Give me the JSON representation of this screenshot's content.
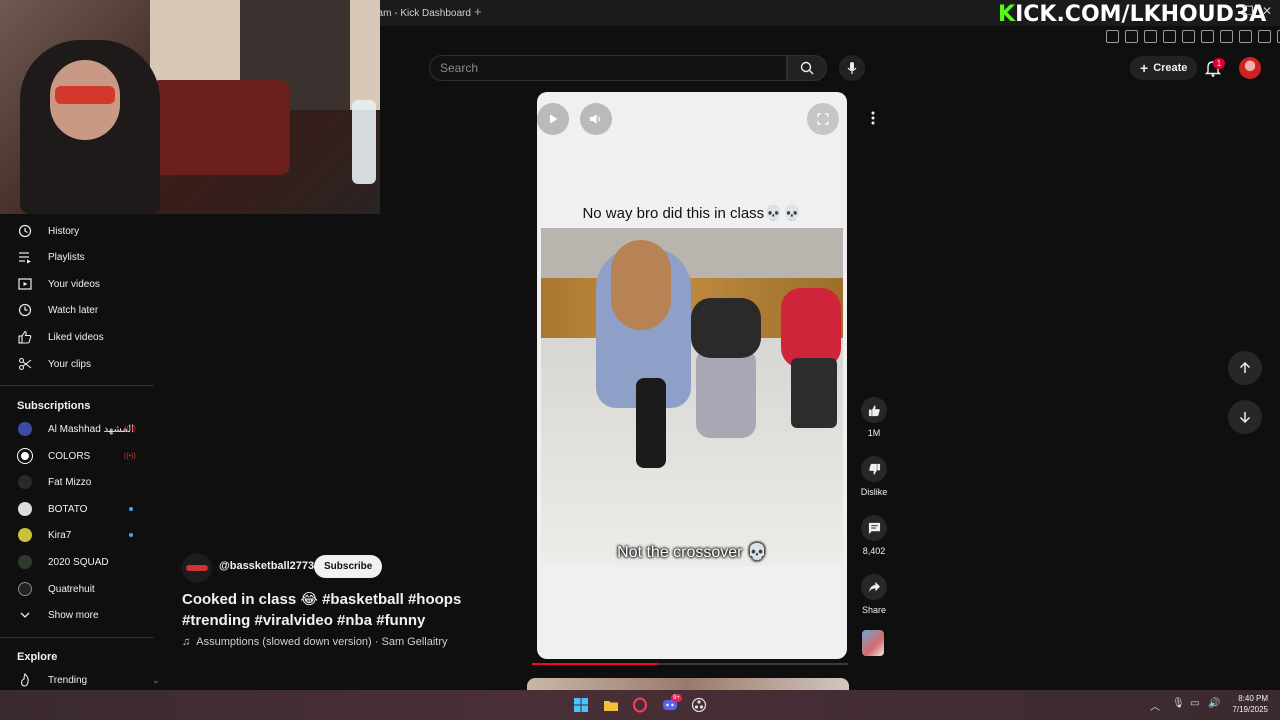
{
  "browser": {
    "tab_title": "eam - Kick Dashboard",
    "brand_prefix": "K",
    "brand_rest": "ICK.COM/LKHOUD3A"
  },
  "masthead": {
    "search_placeholder": "Search",
    "create_label": "Create",
    "notification_count": "1"
  },
  "sidebar": {
    "you_items": [
      {
        "label": "History",
        "icon": "history-icon"
      },
      {
        "label": "Playlists",
        "icon": "playlist-icon"
      },
      {
        "label": "Your videos",
        "icon": "your-videos-icon"
      },
      {
        "label": "Watch later",
        "icon": "clock-icon"
      },
      {
        "label": "Liked videos",
        "icon": "thumbs-up-icon"
      },
      {
        "label": "Your clips",
        "icon": "scissors-icon"
      }
    ],
    "subscriptions_heading": "Subscriptions",
    "subscriptions": [
      {
        "label": "Al Mashhad المشهد",
        "status": "live",
        "color": "#3b4aa8"
      },
      {
        "label": "COLORS",
        "status": "live",
        "color": "#ffffff"
      },
      {
        "label": "Fat Mizzo",
        "status": "",
        "color": "#2a2a2a"
      },
      {
        "label": "BOTATO",
        "status": "new",
        "color": "#dcdcdc"
      },
      {
        "label": "Kira7",
        "status": "new",
        "color": "#c9c23a"
      },
      {
        "label": "2020 SQUAD",
        "status": "",
        "color": "#2e3a2e"
      },
      {
        "label": "Quatrehuit",
        "status": "",
        "color": "#222222"
      }
    ],
    "show_more": "Show more",
    "explore_heading": "Explore",
    "explore_items": [
      {
        "label": "Trending",
        "icon": "trending-icon"
      }
    ]
  },
  "short": {
    "caption_top": "No way bro did this in class💀💀",
    "caption_bottom": "Not the crossover 💀",
    "progress": 0.4
  },
  "actions": {
    "likes": "1M",
    "dislike": "Dislike",
    "comments": "8,402",
    "share": "Share"
  },
  "meta": {
    "channel": "@bassketball2773",
    "subscribe": "Subscribe",
    "title": "Cooked in class 😂 #basketball #hoops #trending #viralvideo #nba #funny",
    "music": "Assumptions (slowed down version) · Sam Gellaitry"
  },
  "taskbar": {
    "discord_badge": "9+",
    "time": "8:40 PM",
    "date": "7/19/2025"
  },
  "colors": {
    "accent_red": "#ff0033",
    "kick_green": "#53fc18",
    "background": "#0f0f0f"
  }
}
